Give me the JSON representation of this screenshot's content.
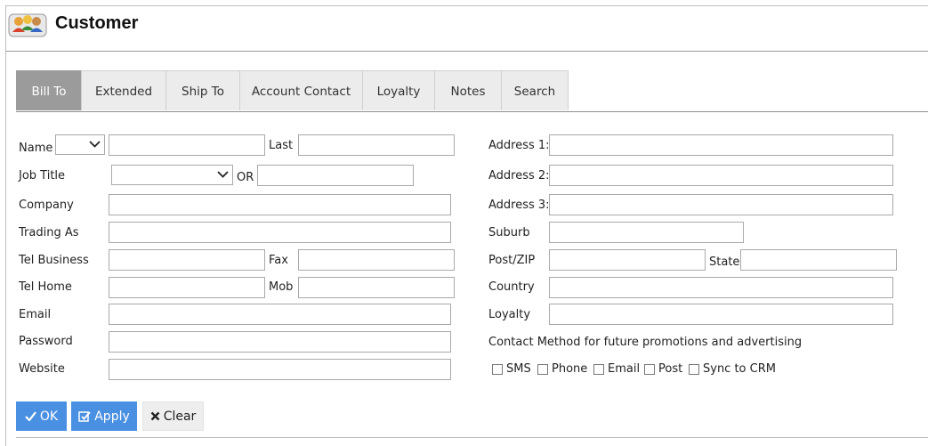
{
  "window": {
    "title": "Customer",
    "icon": "customers-app-icon"
  },
  "tabs": [
    {
      "label": "Bill To",
      "active": true
    },
    {
      "label": "Extended",
      "active": false
    },
    {
      "label": "Ship To",
      "active": false
    },
    {
      "label": "Account Contact",
      "active": false
    },
    {
      "label": "Loyalty",
      "active": false
    },
    {
      "label": "Notes",
      "active": false
    },
    {
      "label": "Search",
      "active": false
    }
  ],
  "form": {
    "name": {
      "label": "Name",
      "title_value": "",
      "first_value": "",
      "last_label": "Last",
      "last_value": ""
    },
    "job_title": {
      "label": "Job Title",
      "select_value": "",
      "or_label": "OR",
      "custom_value": ""
    },
    "company": {
      "label": "Company",
      "value": ""
    },
    "trading_as": {
      "label": "Trading As",
      "value": ""
    },
    "tel_business": {
      "label": "Tel Business",
      "value": "",
      "fax_label": "Fax",
      "fax_value": ""
    },
    "tel_home": {
      "label": "Tel Home",
      "value": "",
      "mob_label": "Mob",
      "mob_value": ""
    },
    "email": {
      "label": "Email",
      "value": ""
    },
    "password": {
      "label": "Password",
      "value": ""
    },
    "website": {
      "label": "Website",
      "value": ""
    },
    "address1": {
      "label": "Address 1:",
      "value": ""
    },
    "address2": {
      "label": "Address 2:",
      "value": ""
    },
    "address3": {
      "label": "Address 3:",
      "value": ""
    },
    "suburb": {
      "label": "Suburb",
      "value": ""
    },
    "post_zip": {
      "label": "Post/ZIP",
      "value": "",
      "state_label": "State",
      "state_value": ""
    },
    "country": {
      "label": "Country",
      "value": ""
    },
    "loyalty": {
      "label": "Loyalty",
      "value": ""
    },
    "contact_method": {
      "heading": "Contact Method for future promotions and advertising",
      "options": [
        {
          "label": "SMS",
          "checked": false
        },
        {
          "label": "Phone",
          "checked": false
        },
        {
          "label": "Email",
          "checked": false
        },
        {
          "label": "Post",
          "checked": false
        },
        {
          "label": "Sync to CRM",
          "checked": false
        }
      ]
    }
  },
  "buttons": {
    "ok": "OK",
    "apply": "Apply",
    "clear": "Clear"
  },
  "colors": {
    "primary": "#4a90e2",
    "tab_active": "#9b9b9b",
    "tab_inactive": "#ececec"
  }
}
